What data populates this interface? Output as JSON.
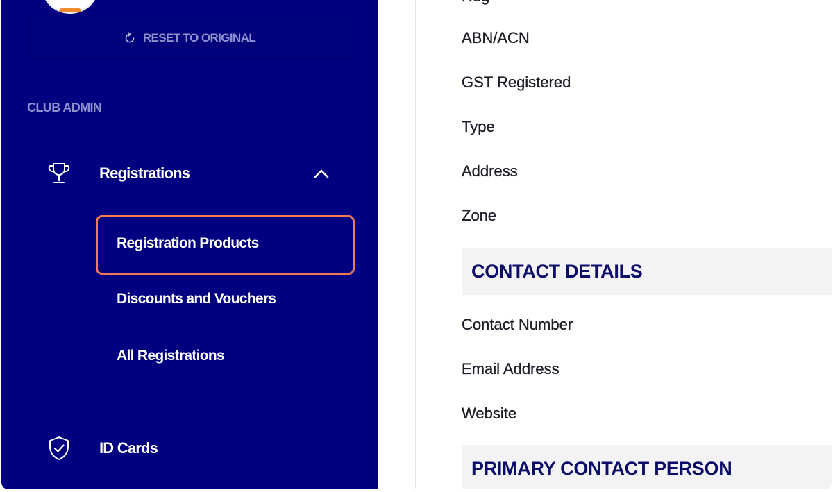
{
  "sidebar": {
    "reset_label": "RESET TO ORIGINAL",
    "section_label": "CLUB ADMIN",
    "registrations": {
      "label": "Registrations",
      "icon": "trophy-icon",
      "expanded": true,
      "sub_items": [
        {
          "label": "Registration Products",
          "active": true
        },
        {
          "label": "Discounts and Vouchers"
        },
        {
          "label": "All Registrations"
        }
      ]
    },
    "id_cards": {
      "label": "ID Cards",
      "icon": "shield-check-icon"
    }
  },
  "content": {
    "fields_group1": [
      {
        "label": "ABN/ACN"
      },
      {
        "label": "GST Registered"
      },
      {
        "label": "Type"
      },
      {
        "label": "Address"
      },
      {
        "label": "Zone"
      }
    ],
    "contact_details": {
      "title": "CONTACT DETAILS",
      "fields": [
        {
          "label": "Contact Number"
        },
        {
          "label": "Email Address"
        },
        {
          "label": "Website"
        }
      ]
    },
    "primary_contact": {
      "title": "PRIMARY CONTACT PERSON"
    }
  },
  "colors": {
    "sidebar_bg": "#000080",
    "highlight_border": "#f07a55",
    "section_header_bg": "#f3f3f6",
    "section_title": "#0c0c6b"
  }
}
